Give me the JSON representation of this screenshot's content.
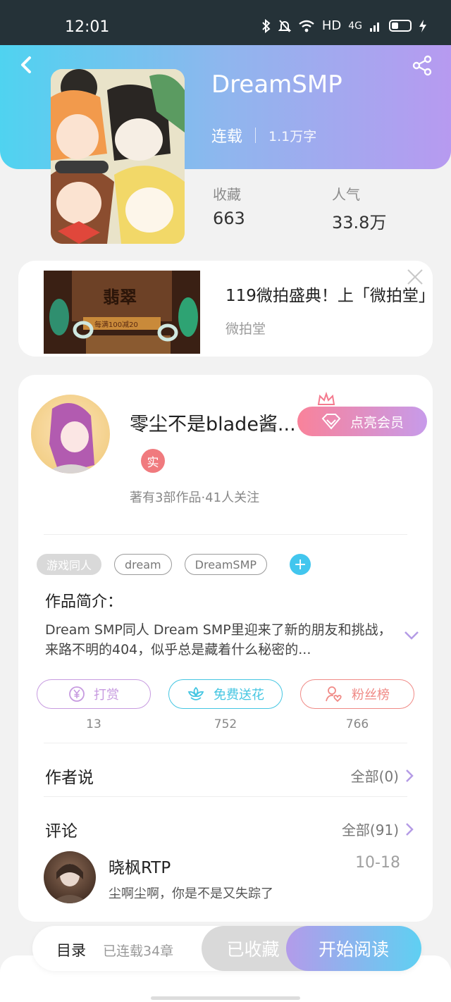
{
  "status_bar": {
    "time": "12:01",
    "hd": "HD",
    "net": "4G"
  },
  "book": {
    "title": "DreamSMP",
    "status": "连载",
    "word_count": "1.1万字",
    "stats": [
      {
        "label": "收藏",
        "value": "663"
      },
      {
        "label": "人气",
        "value": "33.8万"
      }
    ]
  },
  "ad": {
    "image_text": "翡翠",
    "image_subtext": "每满100减20",
    "title": "119微拍盛典！上「微拍堂」",
    "source": "微拍堂"
  },
  "author": {
    "name": "零尘不是blade酱...",
    "vip_button": "点亮会员",
    "badge": "实",
    "stats": "著有3部作品·41人关注"
  },
  "tags": [
    "游戏同人",
    "dream",
    "DreamSMP"
  ],
  "tag_add": "+",
  "intro": {
    "heading": "作品简介：",
    "text": "Dream SMP同人 Dream SMP里迎来了新的朋友和挑战，来路不明的404，似乎总是藏着什么秘密的..."
  },
  "actions": [
    {
      "label": "打赏",
      "count": "13",
      "color": "#c79be0"
    },
    {
      "label": "免费送花",
      "count": "752",
      "color": "#45c6e2"
    },
    {
      "label": "粉丝榜",
      "count": "766",
      "color": "#f08a86"
    }
  ],
  "author_says": {
    "title": "作者说",
    "more": "全部(0)"
  },
  "comments": {
    "title": "评论",
    "more": "全部(91)",
    "items": [
      {
        "user": "晓枫RTP",
        "date": "10-18",
        "text": "尘啊尘啊，你是不是又失踪了"
      }
    ]
  },
  "bottom_bar": {
    "toc": "目录",
    "toc_sub": "已连载34章",
    "fav": "已收藏",
    "read": "开始阅读"
  },
  "colors": {
    "accent_purple": "#b39bea",
    "accent_cyan": "#4fd3f0",
    "vip_pink": "#f9829a"
  }
}
